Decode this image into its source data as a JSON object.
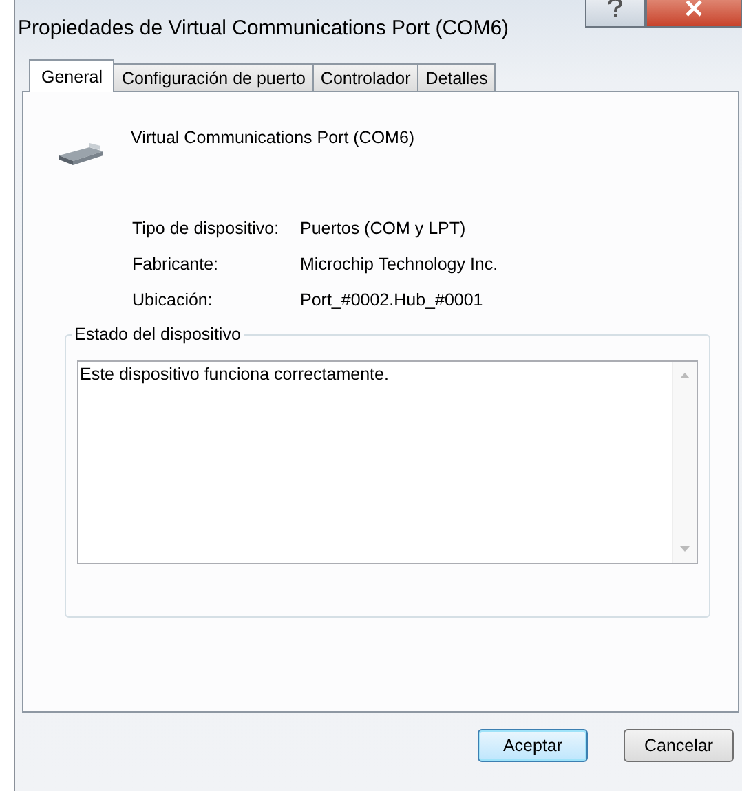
{
  "window": {
    "title": "Propiedades de Virtual Communications Port (COM6)"
  },
  "tabs": [
    {
      "label": "General",
      "selected": true
    },
    {
      "label": "Configuración de puerto",
      "selected": false
    },
    {
      "label": "Controlador",
      "selected": false
    },
    {
      "label": "Detalles",
      "selected": false
    }
  ],
  "device": {
    "name": "Virtual Communications Port (COM6)"
  },
  "properties": [
    {
      "label": "Tipo de dispositivo:",
      "value": "Puertos (COM y LPT)"
    },
    {
      "label": "Fabricante:",
      "value": "Microchip Technology Inc."
    },
    {
      "label": "Ubicación:",
      "value": "Port_#0002.Hub_#0001"
    }
  ],
  "status": {
    "title": "Estado del dispositivo",
    "text": "Este dispositivo funciona correctamente."
  },
  "buttons": [
    {
      "label": "Aceptar",
      "default": true
    },
    {
      "label": "Cancelar",
      "default": false
    }
  ]
}
